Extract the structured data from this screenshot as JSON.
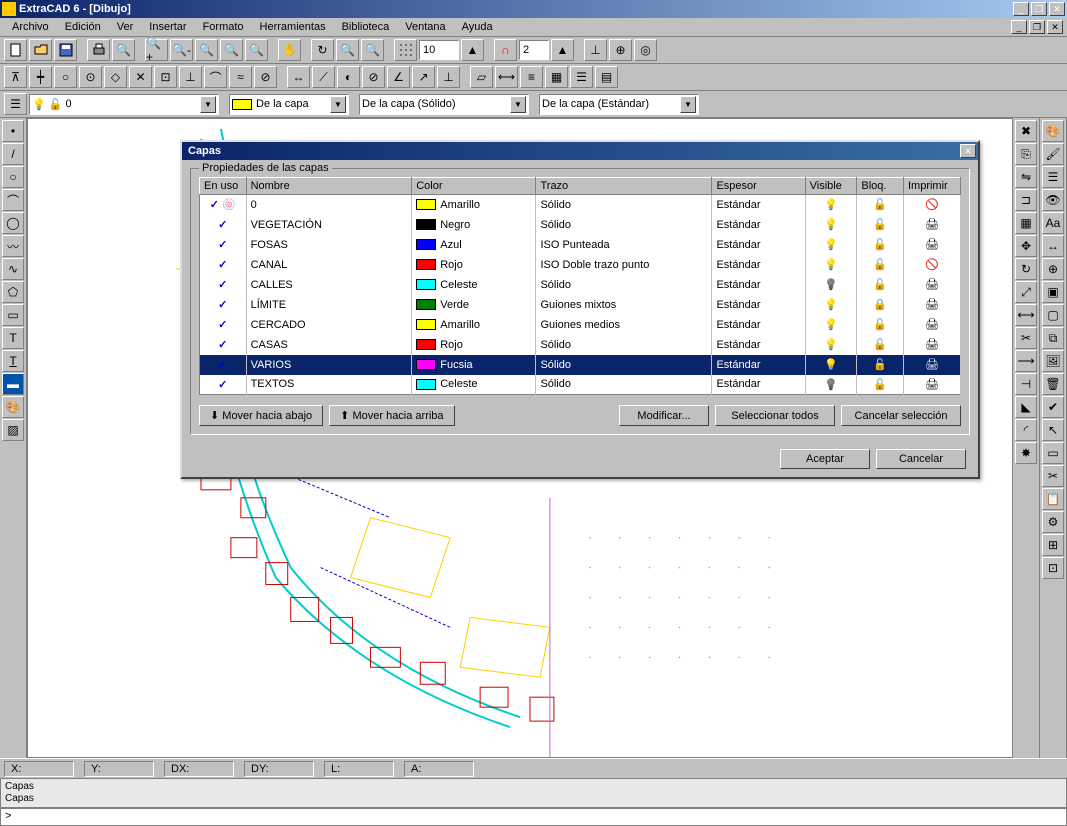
{
  "app": {
    "title": "ExtraCAD 6 - [Dibujo]"
  },
  "menu": {
    "items": [
      "Archivo",
      "Edición",
      "Ver",
      "Insertar",
      "Formato",
      "Herramientas",
      "Biblioteca",
      "Ventana",
      "Ayuda"
    ]
  },
  "toolbar1": {
    "grid_val": "10",
    "snap_val": "2"
  },
  "layerbar": {
    "current_swatch": "amarillo",
    "current_layer": "0",
    "color_combo": "De la capa",
    "linetype_combo": "De la capa (Sólido)",
    "style_combo": "De la capa (Estándar)"
  },
  "dialog": {
    "title": "Capas",
    "group": "Propiedades de las capas",
    "headers": [
      "En uso",
      "Nombre",
      "Color",
      "Trazo",
      "Espesor",
      "Visible",
      "Bloq.",
      "Imprimir"
    ],
    "rows": [
      {
        "used": true,
        "active": true,
        "name": "0",
        "color": "Amarillo",
        "sw": "amarillo",
        "trace": "Sólido",
        "thick": "Estándar",
        "vis": "on",
        "lock": "open",
        "print": "no",
        "sel": false
      },
      {
        "used": true,
        "active": false,
        "name": "VEGETACIÓN",
        "color": "Negro",
        "sw": "negro",
        "trace": "Sólido",
        "thick": "Estándar",
        "vis": "on",
        "lock": "open",
        "print": "yes",
        "sel": false
      },
      {
        "used": true,
        "active": false,
        "name": "FOSAS",
        "color": "Azul",
        "sw": "azul",
        "trace": "ISO Punteada",
        "thick": "Estándar",
        "vis": "on",
        "lock": "open",
        "print": "yes",
        "sel": false
      },
      {
        "used": true,
        "active": false,
        "name": "CANAL",
        "color": "Rojo",
        "sw": "rojo",
        "trace": "ISO Doble trazo punto",
        "thick": "Estándar",
        "vis": "on",
        "lock": "open",
        "print": "no",
        "sel": false
      },
      {
        "used": true,
        "active": false,
        "name": "CALLES",
        "color": "Celeste",
        "sw": "celeste",
        "trace": "Sólido",
        "thick": "Estándar",
        "vis": "off",
        "lock": "open",
        "print": "yes",
        "sel": false
      },
      {
        "used": true,
        "active": false,
        "name": "LÍMITE",
        "color": "Verde",
        "sw": "verde",
        "trace": "Guiones mixtos",
        "thick": "Estándar",
        "vis": "on",
        "lock": "closed",
        "print": "yes",
        "sel": false
      },
      {
        "used": true,
        "active": false,
        "name": "CERCADO",
        "color": "Amarillo",
        "sw": "amarillo",
        "trace": "Guiones medios",
        "thick": "Estándar",
        "vis": "on",
        "lock": "open",
        "print": "yes",
        "sel": false
      },
      {
        "used": true,
        "active": false,
        "name": "CASAS",
        "color": "Rojo",
        "sw": "rojo",
        "trace": "Sólido",
        "thick": "Estándar",
        "vis": "on",
        "lock": "open",
        "print": "yes",
        "sel": false
      },
      {
        "used": true,
        "active": false,
        "name": "VARIOS",
        "color": "Fucsia",
        "sw": "fucsia",
        "trace": "Sólido",
        "thick": "Estándar",
        "vis": "on",
        "lock": "open",
        "print": "yes",
        "sel": true
      },
      {
        "used": true,
        "active": false,
        "name": "TEXTOS",
        "color": "Celeste",
        "sw": "celeste",
        "trace": "Sólido",
        "thick": "Estándar",
        "vis": "off",
        "lock": "open",
        "print": "yes",
        "sel": false
      }
    ],
    "buttons": {
      "move_down": "Mover hacia abajo",
      "move_up": "Mover hacia arriba",
      "modify": "Modificar...",
      "select_all": "Seleccionar todos",
      "cancel_sel": "Cancelar selección",
      "ok": "Aceptar",
      "cancel": "Cancelar"
    }
  },
  "status": {
    "x": "X:",
    "y": "Y:",
    "dx": "DX:",
    "dy": "DY:",
    "l": "L:",
    "a": "A:"
  },
  "cmd": {
    "history": "Capas\nCapas",
    "prompt": ">"
  }
}
